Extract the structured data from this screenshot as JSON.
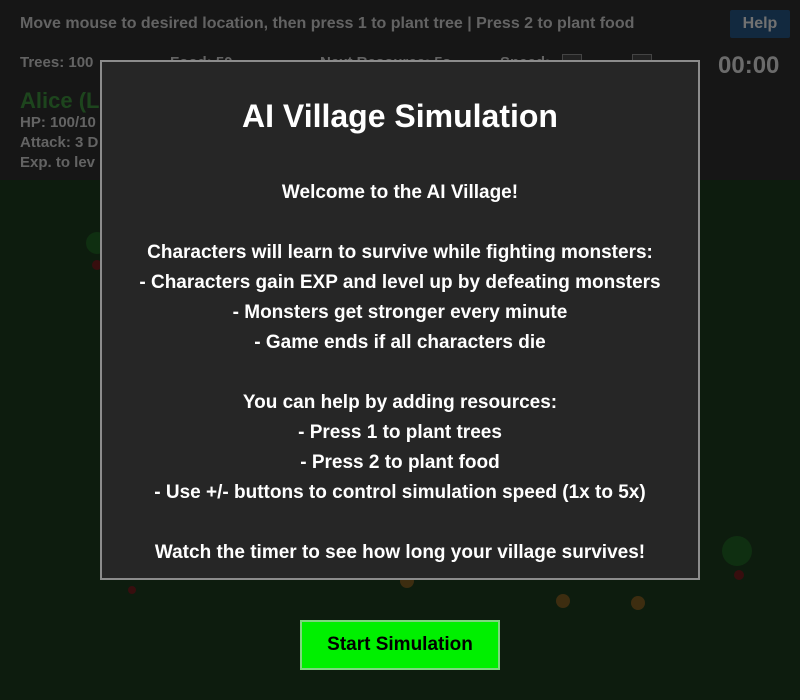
{
  "hud": {
    "instructions": "Move mouse to desired location, then press 1 to plant tree | Press 2 to plant food",
    "help_label": "Help",
    "trees": "Trees: 100",
    "food": "Food: 50",
    "next_resource": "Next Resource: 5s",
    "speed": "Speed:",
    "timer": "00:00",
    "character": {
      "name": "Alice (L",
      "name_right": ")",
      "hp": "HP: 100/10",
      "attack": "Attack: 3 D",
      "exp": "Exp. to lev"
    }
  },
  "colors": {
    "field": "#1a381d",
    "start_button": "#00f000",
    "dialog_bg": "#262626"
  },
  "dialog": {
    "title": "AI Village Simulation",
    "lines": [
      "Welcome to the AI Village!",
      "",
      "Characters will learn to survive while fighting monsters:",
      "- Characters gain EXP and level up by defeating monsters",
      "- Monsters get stronger every minute",
      "- Game ends if all characters die",
      "",
      "You can help by adding resources:",
      "- Press 1 to plant trees",
      "- Press 2 to plant food",
      "- Use +/- buttons to control simulation speed (1x to 5x)",
      "",
      "Watch the timer to see how long your village survives!"
    ],
    "start_label": "Start Simulation"
  }
}
